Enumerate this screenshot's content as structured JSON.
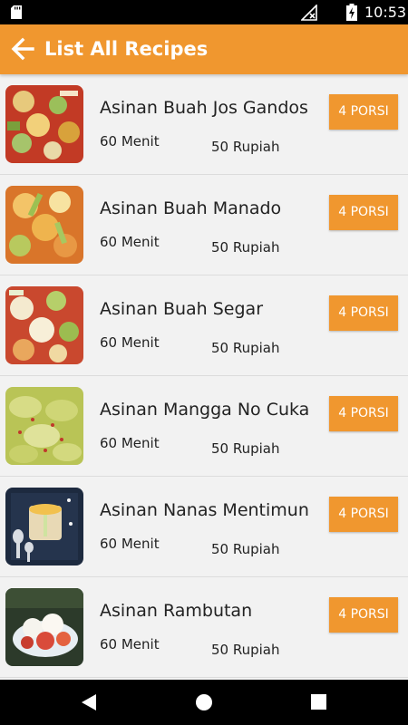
{
  "status_bar": {
    "time": "10:53",
    "icons": [
      "sd-card-icon",
      "signal-icon",
      "battery-charging-icon"
    ]
  },
  "app_bar": {
    "title": "List All Recipes",
    "back_icon": "arrow-left-icon",
    "color": "#f0972f"
  },
  "recipes": [
    {
      "name": "Asinan Buah Jos Gandos",
      "time": "60 Menit",
      "price": "50 Rupiah",
      "portion": "4 PORSI"
    },
    {
      "name": "Asinan Buah Manado",
      "time": "60 Menit",
      "price": "50 Rupiah",
      "portion": "4 PORSI"
    },
    {
      "name": "Asinan Buah Segar",
      "time": "60 Menit",
      "price": "50 Rupiah",
      "portion": "4 PORSI"
    },
    {
      "name": "Asinan Mangga No Cuka",
      "time": "60 Menit",
      "price": "50 Rupiah",
      "portion": "4 PORSI"
    },
    {
      "name": "Asinan Nanas Mentimun",
      "time": "60 Menit",
      "price": "50 Rupiah",
      "portion": "4 PORSI"
    },
    {
      "name": "Asinan Rambutan",
      "time": "60 Menit",
      "price": "50 Rupiah",
      "portion": "4 PORSI"
    }
  ],
  "nav_bar": {
    "icons": [
      "back-triangle-icon",
      "home-circle-icon",
      "recents-square-icon"
    ]
  }
}
